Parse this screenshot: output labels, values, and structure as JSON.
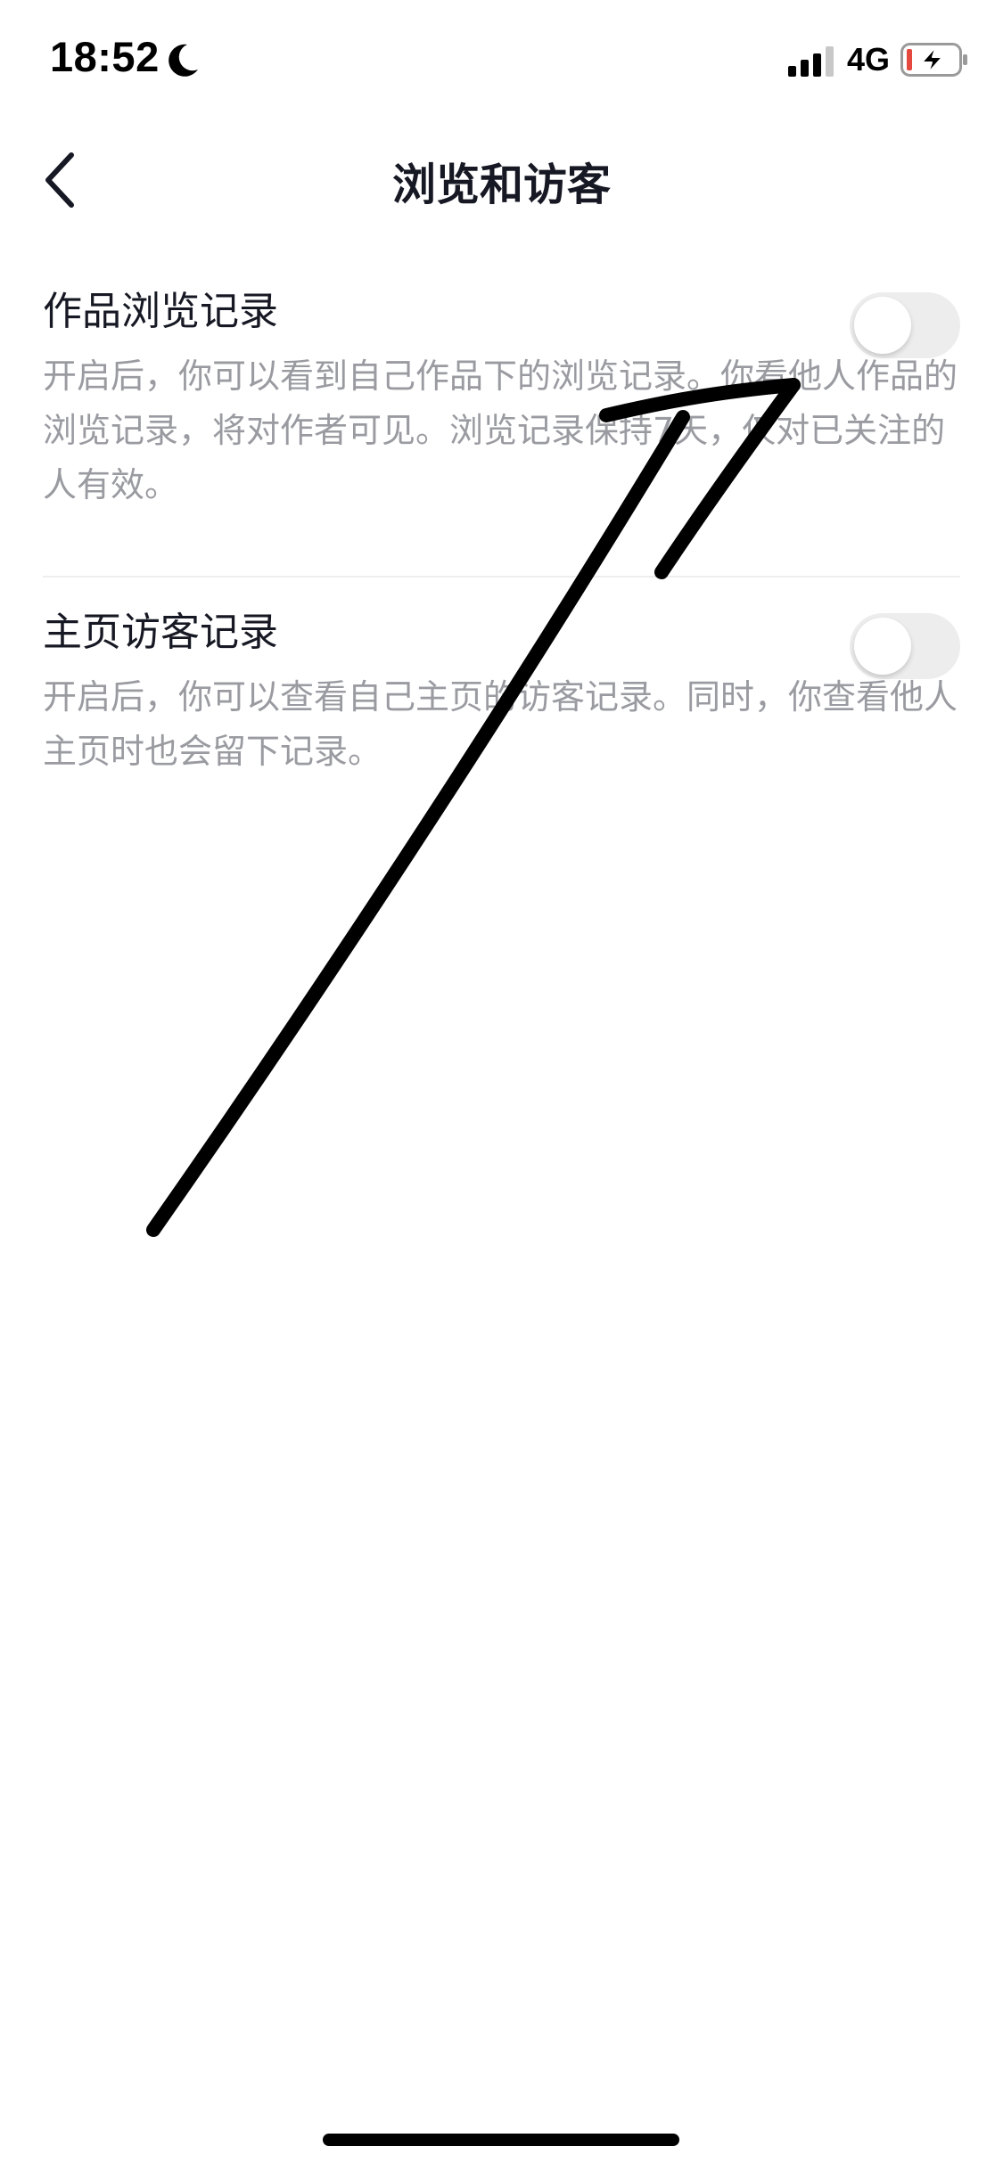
{
  "status_bar": {
    "time": "18:52",
    "network": "4G",
    "icons": [
      "moon-icon",
      "signal-icon",
      "battery-charging-icon"
    ]
  },
  "header": {
    "title": "浏览和访客",
    "back_icon": "chevron-left-icon"
  },
  "settings": [
    {
      "title": "作品浏览记录",
      "description": "开启后，你可以看到自己作品下的浏览记录。你看他人作品的浏览记录，将对作者可见。浏览记录保持7天，仅对已关注的人有效。",
      "enabled": false
    },
    {
      "title": "主页访客记录",
      "description": "开启后，你可以查看自己主页的访客记录。同时，你查看他人主页时也会留下记录。",
      "enabled": false
    }
  ],
  "colors": {
    "title_text": "#161823",
    "description_text": "#9a9ba1",
    "toggle_off_track": "#ededee",
    "battery_low": "#e5483e",
    "annotation_stroke": "#000000"
  }
}
